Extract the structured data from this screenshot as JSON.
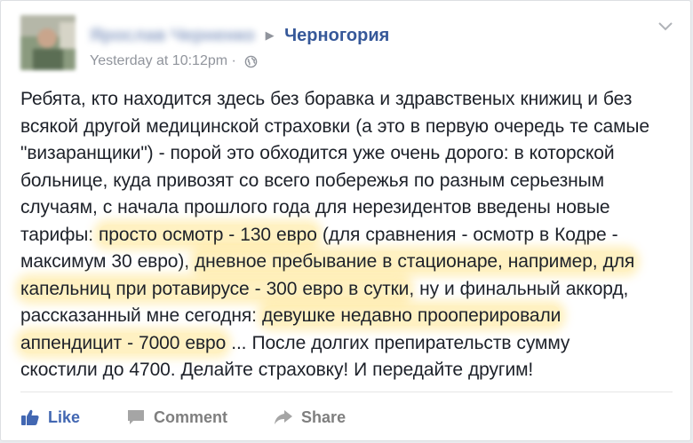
{
  "post": {
    "author_name": "Ярослав Черненко",
    "group_name": "Черногория",
    "timestamp": "Yesterday at 10:12pm",
    "separator": "·",
    "privacy_icon": "globe-icon",
    "menu_icon": "chevron-down-icon",
    "text_lines": [
      "Ребята, кто находится здесь без боравка и здравственых книжиц и без",
      "всякой другой медицинской страховки (а это в первую очередь те самые",
      "\"визаранщики\") - порой это обходится уже очень дорого: в которской",
      "больнице, куда привозят со всего побережья по разным серьезным",
      "случаям, с начала прошлого года для нерезидентов введены новые"
    ],
    "line6": {
      "a": "тарифы: ",
      "hl": "просто осмотр - 130 евро",
      "b": " (для сравнения - осмотр в Кодре -"
    },
    "line7": {
      "a": "максимум 30 евро), ",
      "hl": "дневное пребывание в стационаре, например, для"
    },
    "line8": {
      "hl": "капельниц при ротавирусе - 300 евро в сутки",
      "b": ", ну и финальный аккорд,"
    },
    "line9": {
      "a": "рассказанный мне сегодня: ",
      "hl": "девушке недавно прооперировали"
    },
    "line10": {
      "hl": "аппендицит - 7000 евро",
      "b": " ... После долгих препирательств сумму"
    },
    "line11": "скостили до 4700. Делайте страховку! И передайте другим!",
    "highlight_color": "#ffe078"
  },
  "actions": {
    "like_label": "Like",
    "comment_label": "Comment",
    "share_label": "Share",
    "like_color": "#4267b2",
    "muted_color": "#7f7f7f"
  }
}
